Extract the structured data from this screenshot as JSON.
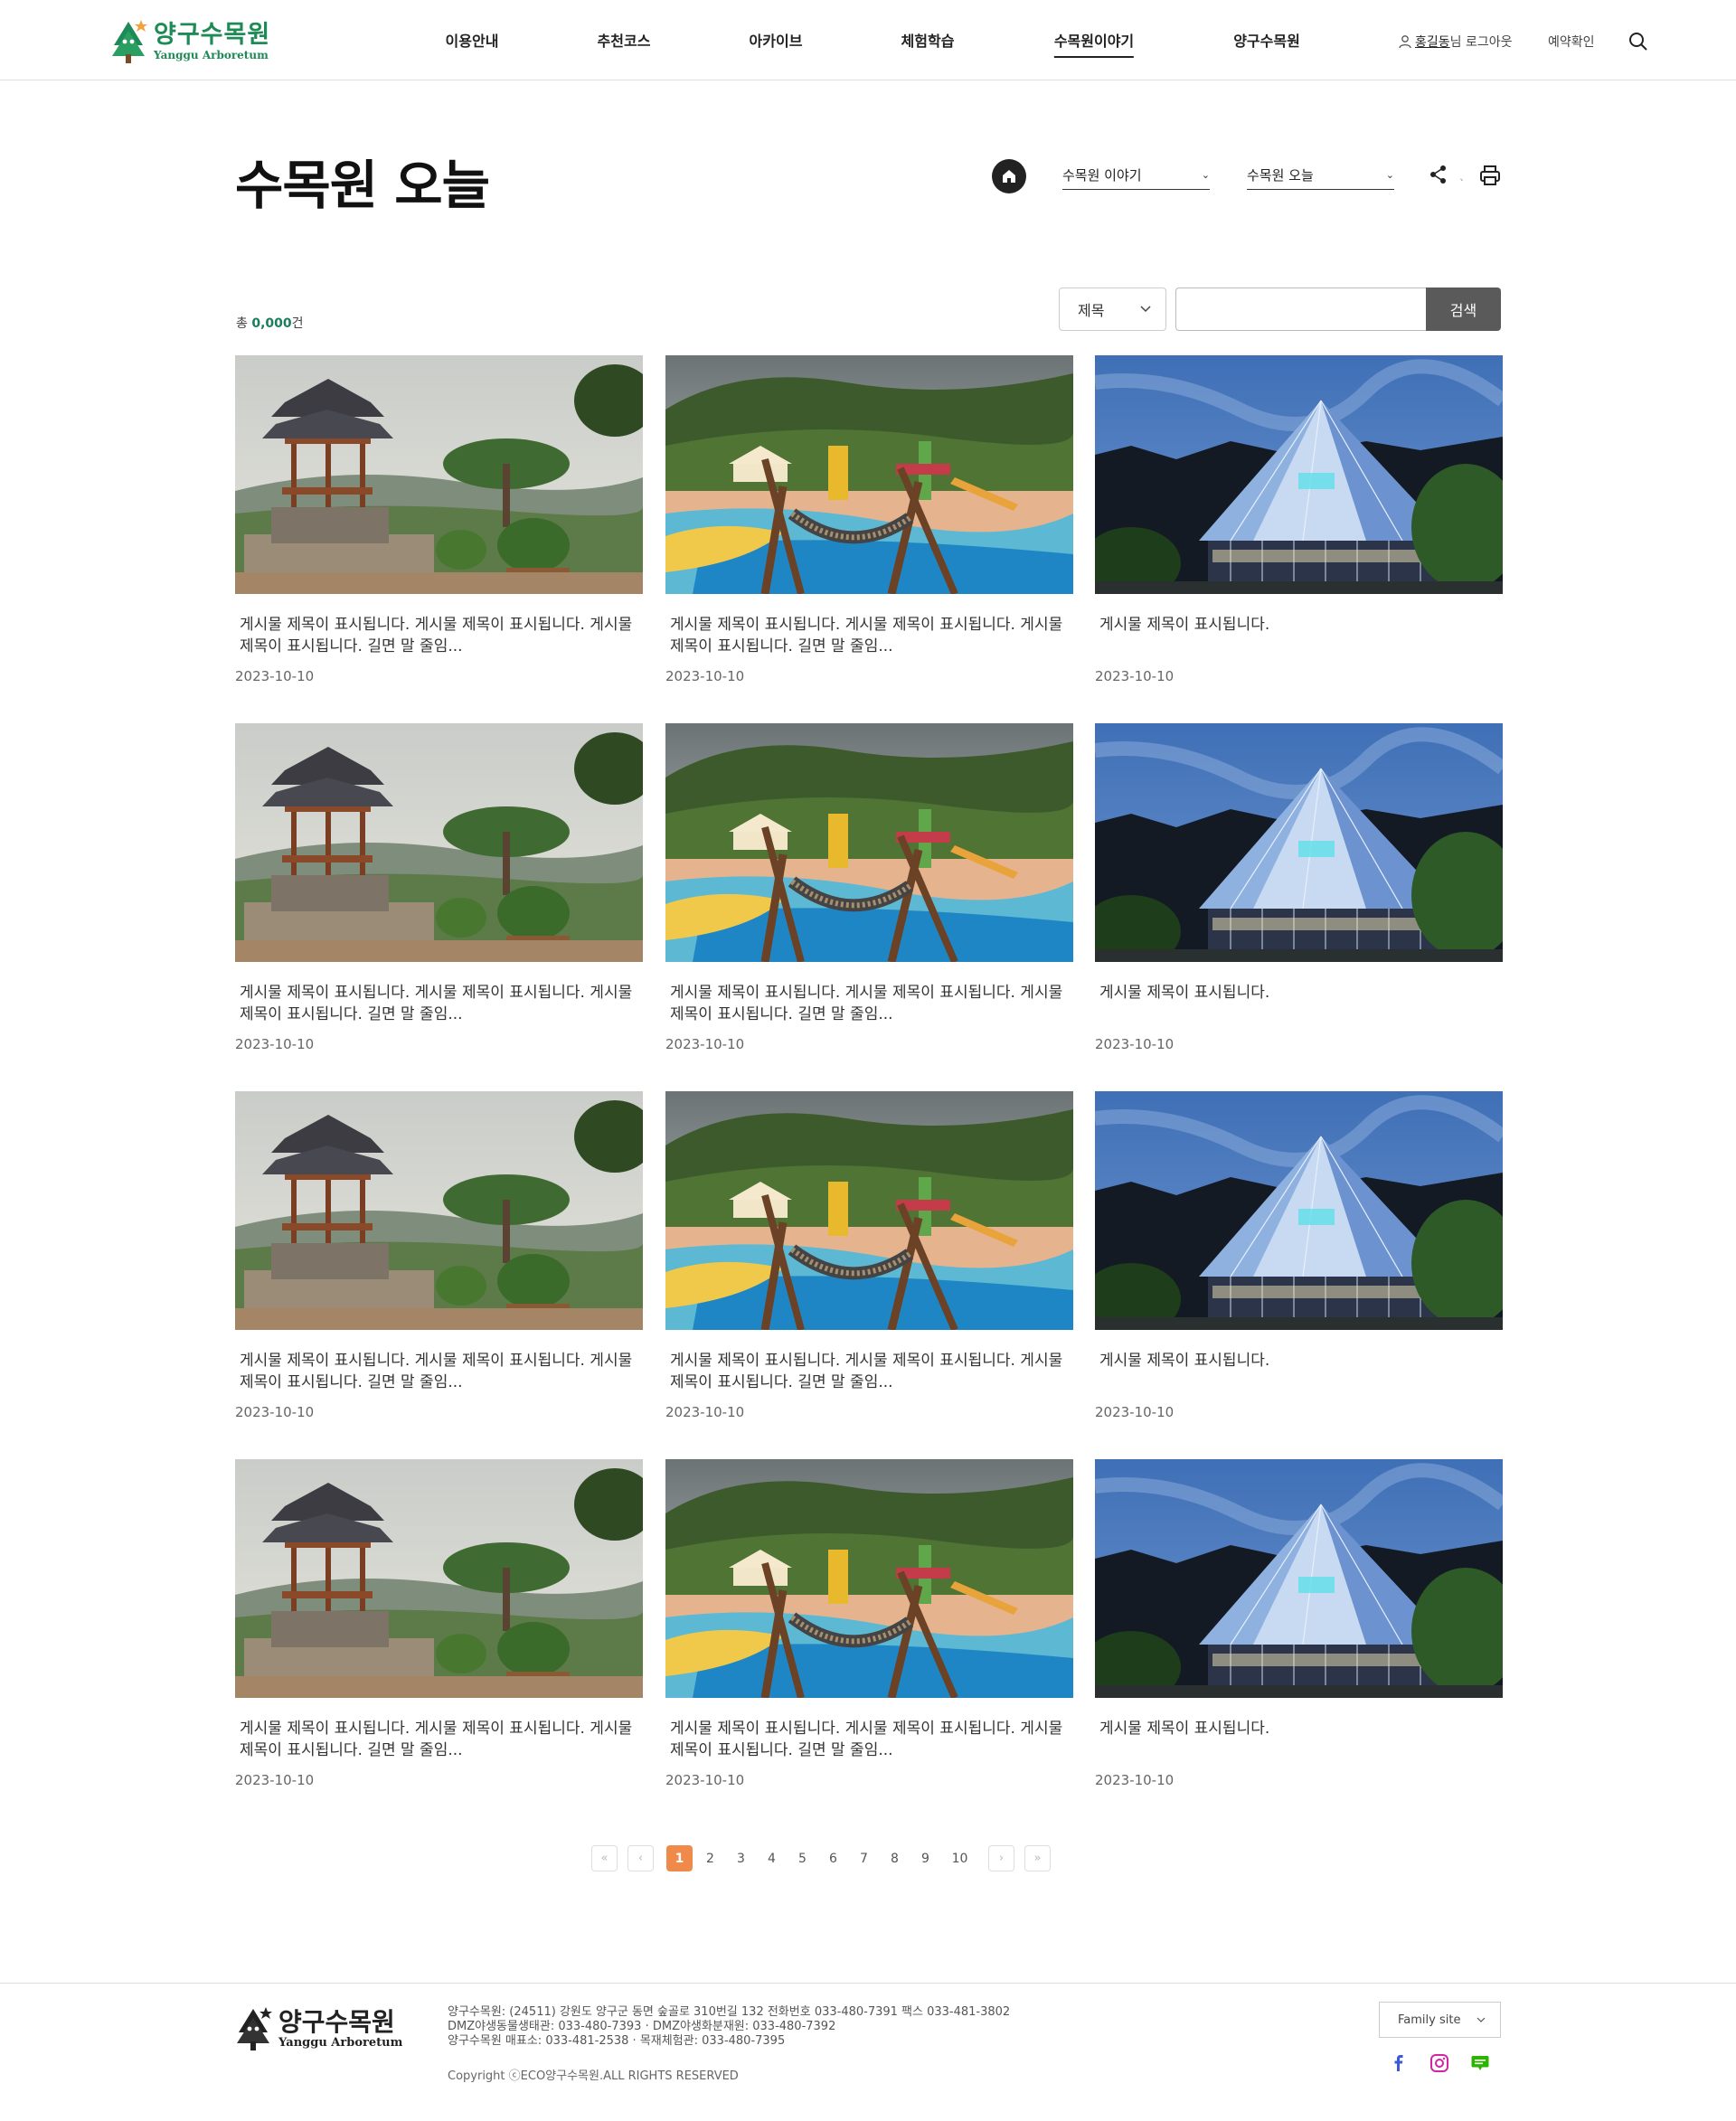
{
  "header": {
    "logo_ko": "양구수목원",
    "logo_en": "Yanggu Arboretum",
    "nav": [
      {
        "label": "이용안내",
        "active": false
      },
      {
        "label": "추천코스",
        "active": false
      },
      {
        "label": "아카이브",
        "active": false
      },
      {
        "label": "체험학습",
        "active": false
      },
      {
        "label": "수목원이야기",
        "active": true
      },
      {
        "label": "양구수목원",
        "active": false
      }
    ],
    "user_name": "홍길동",
    "user_suffix": "님 로그아웃",
    "reservation": "예약확인",
    "icons": {
      "user": "user-icon",
      "search": "search-icon"
    }
  },
  "page": {
    "title": "수목원 오늘",
    "breadcrumb": {
      "home_icon": "home-icon",
      "level1": "수목원 이야기",
      "level2": "수목원 오늘"
    },
    "share_icon": "share-icon",
    "print_icon": "print-icon"
  },
  "list": {
    "total_prefix": "총 ",
    "total_count": "0,000",
    "total_suffix": "건",
    "search_field": "제목",
    "search_value": "",
    "search_button": "검색",
    "posts": [
      {
        "title": "게시물 제목이 표시됩니다. 게시물 제목이 표시됩니다. 게시물 제목이 표시됩니다. 길면 말 줄임...",
        "date": "2023-10-10",
        "image": "pavilion"
      },
      {
        "title": "게시물 제목이 표시됩니다. 게시물 제목이 표시됩니다. 게시물 제목이 표시됩니다. 길면 말 줄임...",
        "date": "2023-10-10",
        "image": "playground"
      },
      {
        "title": "게시물 제목이 표시됩니다.",
        "date": "2023-10-10",
        "image": "greenhouse"
      },
      {
        "title": "게시물 제목이 표시됩니다. 게시물 제목이 표시됩니다. 게시물 제목이 표시됩니다. 길면 말 줄임...",
        "date": "2023-10-10",
        "image": "pavilion"
      },
      {
        "title": "게시물 제목이 표시됩니다. 게시물 제목이 표시됩니다. 게시물 제목이 표시됩니다. 길면 말 줄임...",
        "date": "2023-10-10",
        "image": "playground"
      },
      {
        "title": "게시물 제목이 표시됩니다.",
        "date": "2023-10-10",
        "image": "greenhouse"
      },
      {
        "title": "게시물 제목이 표시됩니다. 게시물 제목이 표시됩니다. 게시물 제목이 표시됩니다. 길면 말 줄임...",
        "date": "2023-10-10",
        "image": "pavilion"
      },
      {
        "title": "게시물 제목이 표시됩니다. 게시물 제목이 표시됩니다. 게시물 제목이 표시됩니다. 길면 말 줄임...",
        "date": "2023-10-10",
        "image": "playground"
      },
      {
        "title": "게시물 제목이 표시됩니다.",
        "date": "2023-10-10",
        "image": "greenhouse"
      },
      {
        "title": "게시물 제목이 표시됩니다. 게시물 제목이 표시됩니다. 게시물 제목이 표시됩니다. 길면 말 줄임...",
        "date": "2023-10-10",
        "image": "pavilion"
      },
      {
        "title": "게시물 제목이 표시됩니다. 게시물 제목이 표시됩니다. 게시물 제목이 표시됩니다. 길면 말 줄임...",
        "date": "2023-10-10",
        "image": "playground"
      },
      {
        "title": "게시물 제목이 표시됩니다.",
        "date": "2023-10-10",
        "image": "greenhouse"
      }
    ]
  },
  "pagination": {
    "pages": [
      "1",
      "2",
      "3",
      "4",
      "5",
      "6",
      "7",
      "8",
      "9",
      "10"
    ],
    "current": "1",
    "first_icon": "double-chevron-left-icon",
    "prev_icon": "chevron-left-icon",
    "next_icon": "chevron-right-icon",
    "last_icon": "double-chevron-right-icon"
  },
  "footer": {
    "logo_ko": "양구수목원",
    "logo_en": "Yanggu Arboretum",
    "info_lines": [
      "양구수목원: (24511) 강원도 양구군 동면 숲골로 310번길 132 전화번호 033-480-7391 팩스 033-481-3802",
      "DMZ야생동물생태관: 033-480-7393 · DMZ야생화분재원: 033-480-7392",
      "양구수목원 매표소: 033-481-2538 · 목재체험관: 033-480-7395"
    ],
    "copyright": "Copyright ⓒECO양구수목원.ALL RIGHTS RESERVED",
    "family_site": "Family site",
    "sns": [
      {
        "name": "facebook-icon",
        "color": "#3b5ad9"
      },
      {
        "name": "instagram-icon",
        "color": "#d6249f"
      },
      {
        "name": "blog-icon",
        "color": "#2db400"
      }
    ]
  },
  "colors": {
    "brand_green": "#1e8a55",
    "count_green": "#1a7e5a",
    "pager_active": "#f08a4b",
    "search_button": "#5a5a5a"
  }
}
